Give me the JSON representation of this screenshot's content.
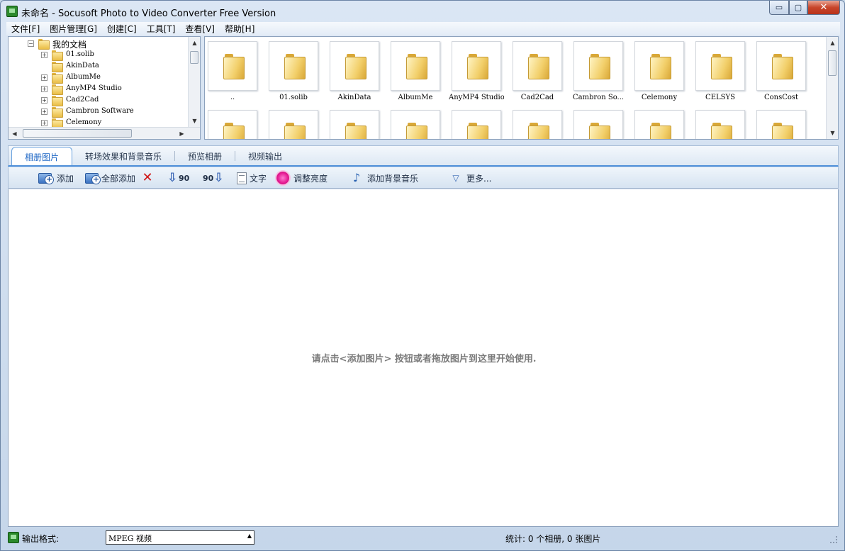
{
  "window": {
    "title": "未命名 - Socusoft Photo to Video Converter Free Version",
    "minimize_glyph": "▭",
    "maximize_glyph": "▢",
    "close_glyph": "✕"
  },
  "menu": [
    "文件[F]",
    "图片管理[G]",
    "创建[C]",
    "工具[T]",
    "查看[V]",
    "帮助[H]"
  ],
  "tree": {
    "root": "我的文档",
    "items": [
      "01.solib",
      "AkinData",
      "AlbumMe",
      "AnyMP4 Studio",
      "Cad2Cad",
      "Cambron Software",
      "Celemony"
    ]
  },
  "thumbnails": {
    "row1": [
      "..",
      "01.solib",
      "AkinData",
      "AlbumMe",
      "AnyMP4 Studio",
      "Cad2Cad",
      "Cambron So...",
      "Celemony",
      "CELSYS",
      "ConsCost"
    ],
    "row2_count_note": ""
  },
  "tabs": [
    {
      "label": "相册图片",
      "active": true
    },
    {
      "label": "转场效果和背景音乐",
      "active": false
    },
    {
      "label": "预览相册",
      "active": false
    },
    {
      "label": "视频输出",
      "active": false
    }
  ],
  "toolbar": {
    "add": "添加",
    "add_all": "全部添加",
    "rotate_left_num": "90",
    "rotate_right_num": "90",
    "text": "文字",
    "brightness": "调整亮度",
    "add_music": "添加背景音乐",
    "more": "更多..."
  },
  "main": {
    "hint": "请点击<添加图片> 按钮或者拖放图片到这里开始使用."
  },
  "status": {
    "output_label": "输出格式:",
    "output_value": "MPEG 视频",
    "stats": "统计: 0 个相册, 0 张图片"
  },
  "colors": {
    "accent": "#4d8ed8",
    "close_button": "#c8452a"
  }
}
